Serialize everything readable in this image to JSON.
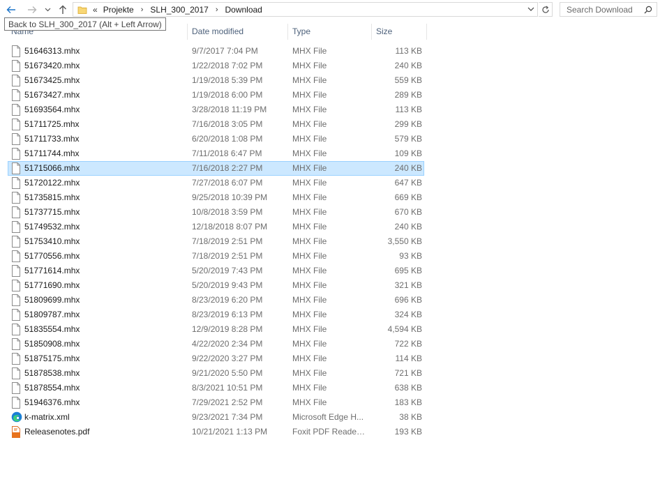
{
  "nav": {
    "breadcrumb_overflow": "«",
    "breadcrumbs": [
      "Projekte",
      "SLH_300_2017",
      "Download"
    ]
  },
  "search": {
    "placeholder": "Search Download"
  },
  "tooltip": {
    "text": "Back to SLH_300_2017 (Alt + Left Arrow)"
  },
  "columns": {
    "name": "Name",
    "date": "Date modified",
    "type": "Type",
    "size": "Size"
  },
  "files": [
    {
      "name": "51646313.mhx",
      "date": "9/7/2017 7:04 PM",
      "type": "MHX File",
      "size": "113 KB",
      "icon": "file-icon"
    },
    {
      "name": "51673420.mhx",
      "date": "1/22/2018 7:02 PM",
      "type": "MHX File",
      "size": "240 KB",
      "icon": "file-icon"
    },
    {
      "name": "51673425.mhx",
      "date": "1/19/2018 5:39 PM",
      "type": "MHX File",
      "size": "559 KB",
      "icon": "file-icon"
    },
    {
      "name": "51673427.mhx",
      "date": "1/19/2018 6:00 PM",
      "type": "MHX File",
      "size": "289 KB",
      "icon": "file-icon"
    },
    {
      "name": "51693564.mhx",
      "date": "3/28/2018 11:19 PM",
      "type": "MHX File",
      "size": "113 KB",
      "icon": "file-icon"
    },
    {
      "name": "51711725.mhx",
      "date": "7/16/2018 3:05 PM",
      "type": "MHX File",
      "size": "299 KB",
      "icon": "file-icon"
    },
    {
      "name": "51711733.mhx",
      "date": "6/20/2018 1:08 PM",
      "type": "MHX File",
      "size": "579 KB",
      "icon": "file-icon"
    },
    {
      "name": "51711744.mhx",
      "date": "7/11/2018 6:47 PM",
      "type": "MHX File",
      "size": "109 KB",
      "icon": "file-icon"
    },
    {
      "name": "51715066.mhx",
      "date": "7/16/2018 2:27 PM",
      "type": "MHX File",
      "size": "240 KB",
      "icon": "file-icon",
      "selected": true
    },
    {
      "name": "51720122.mhx",
      "date": "7/27/2018 6:07 PM",
      "type": "MHX File",
      "size": "647 KB",
      "icon": "file-icon"
    },
    {
      "name": "51735815.mhx",
      "date": "9/25/2018 10:39 PM",
      "type": "MHX File",
      "size": "669 KB",
      "icon": "file-icon"
    },
    {
      "name": "51737715.mhx",
      "date": "10/8/2018 3:59 PM",
      "type": "MHX File",
      "size": "670 KB",
      "icon": "file-icon"
    },
    {
      "name": "51749532.mhx",
      "date": "12/18/2018 8:07 PM",
      "type": "MHX File",
      "size": "240 KB",
      "icon": "file-icon"
    },
    {
      "name": "51753410.mhx",
      "date": "7/18/2019 2:51 PM",
      "type": "MHX File",
      "size": "3,550 KB",
      "icon": "file-icon"
    },
    {
      "name": "51770556.mhx",
      "date": "7/18/2019 2:51 PM",
      "type": "MHX File",
      "size": "93 KB",
      "icon": "file-icon"
    },
    {
      "name": "51771614.mhx",
      "date": "5/20/2019 7:43 PM",
      "type": "MHX File",
      "size": "695 KB",
      "icon": "file-icon"
    },
    {
      "name": "51771690.mhx",
      "date": "5/20/2019 9:43 PM",
      "type": "MHX File",
      "size": "321 KB",
      "icon": "file-icon"
    },
    {
      "name": "51809699.mhx",
      "date": "8/23/2019 6:20 PM",
      "type": "MHX File",
      "size": "696 KB",
      "icon": "file-icon"
    },
    {
      "name": "51809787.mhx",
      "date": "8/23/2019 6:13 PM",
      "type": "MHX File",
      "size": "324 KB",
      "icon": "file-icon"
    },
    {
      "name": "51835554.mhx",
      "date": "12/9/2019 8:28 PM",
      "type": "MHX File",
      "size": "4,594 KB",
      "icon": "file-icon"
    },
    {
      "name": "51850908.mhx",
      "date": "4/22/2020 2:34 PM",
      "type": "MHX File",
      "size": "722 KB",
      "icon": "file-icon"
    },
    {
      "name": "51875175.mhx",
      "date": "9/22/2020 3:27 PM",
      "type": "MHX File",
      "size": "114 KB",
      "icon": "file-icon"
    },
    {
      "name": "51878538.mhx",
      "date": "9/21/2020 5:50 PM",
      "type": "MHX File",
      "size": "721 KB",
      "icon": "file-icon"
    },
    {
      "name": "51878554.mhx",
      "date": "8/3/2021 10:51 PM",
      "type": "MHX File",
      "size": "638 KB",
      "icon": "file-icon"
    },
    {
      "name": "51946376.mhx",
      "date": "7/29/2021 2:52 PM",
      "type": "MHX File",
      "size": "183 KB",
      "icon": "file-icon"
    },
    {
      "name": "k-matrix.xml",
      "date": "9/23/2021 7:34 PM",
      "type": "Microsoft Edge H...",
      "size": "38 KB",
      "icon": "edge-icon"
    },
    {
      "name": "Releasenotes.pdf",
      "date": "10/21/2021 1:13 PM",
      "type": "Foxit PDF Reader ...",
      "size": "193 KB",
      "icon": "pdf-icon"
    }
  ],
  "colors": {
    "selection_bg": "#cce8ff",
    "selection_border": "#99d1ff",
    "back_arrow": "#1a73c9",
    "folder": "#f8d775"
  }
}
